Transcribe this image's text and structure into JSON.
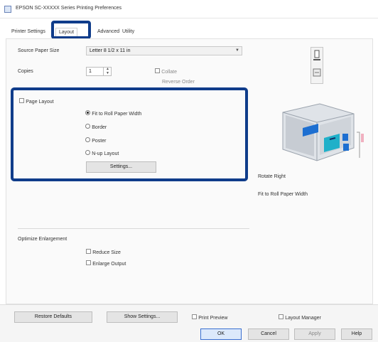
{
  "window": {
    "title": "EPSON SC-XXXXX Series Printing Preferences",
    "icon": "printer-app-icon"
  },
  "tabs": [
    {
      "label": "Printer Settings"
    },
    {
      "label": "Layout"
    },
    {
      "label": "Advanced"
    },
    {
      "label": "Utility"
    }
  ],
  "active_tab": 1,
  "layout": {
    "paper_size_label": "Source Paper Size",
    "paper_size_value": "Letter 8 1/2 x 11 in",
    "copies_label": "Copies",
    "copies_value": "1",
    "collate_label": "Collate",
    "reverse_order_label": "Reverse Order",
    "orientation_icons": [
      "portrait-icon",
      "landscape-icon"
    ]
  },
  "page_layout": {
    "checkbox_label": "Page Layout",
    "options": [
      {
        "label": "Fit to Roll Paper Width"
      },
      {
        "label": "Border"
      },
      {
        "label": "Poster"
      },
      {
        "label": "N-up Layout"
      }
    ],
    "selected_index": 0,
    "settings_button": "Settings..."
  },
  "preview": {
    "label_1": "Rotate Right",
    "label_2": "Fit to Roll Paper Width"
  },
  "optimize": {
    "title": "Optimize Enlargement",
    "options": [
      {
        "label": "Reduce Size"
      },
      {
        "label": "Enlarge Output"
      }
    ]
  },
  "footer": {
    "restore_defaults": "Restore Defaults",
    "show_settings": "Show Settings...",
    "print_preview": "Print Preview",
    "layout_manager": "Layout Manager",
    "ok": "OK",
    "cancel": "Cancel",
    "apply": "Apply",
    "help": "Help"
  },
  "colors": {
    "highlight": "#0f3c8a",
    "accent_blue": "#1d6fd1",
    "printer_gray": "#b7bcc4"
  }
}
